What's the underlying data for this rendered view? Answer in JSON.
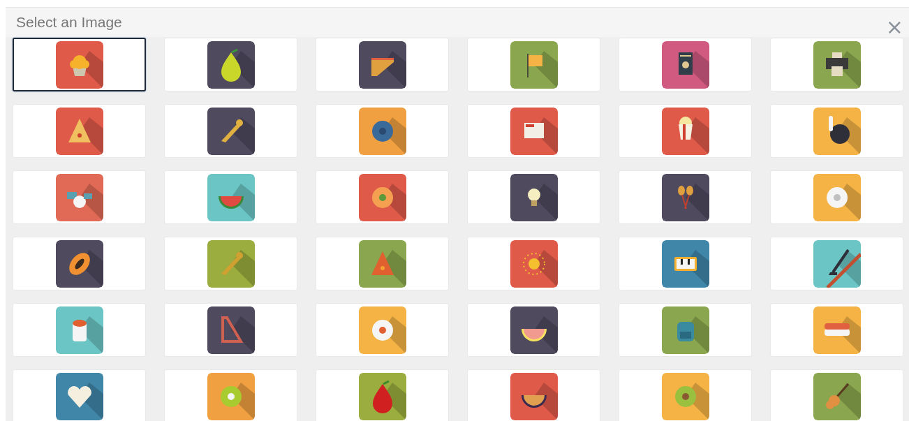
{
  "dialog": {
    "title": "Select an Image",
    "close": "×"
  },
  "tiles": [
    {
      "selected": true,
      "color": "#e05a4a"
    },
    {
      "selected": false,
      "color": "#4f4a5e"
    },
    {
      "selected": false,
      "color": "#4f4a5e"
    },
    {
      "selected": false,
      "color": "#8aa64e"
    },
    {
      "selected": false,
      "color": "#d05a80"
    },
    {
      "selected": false,
      "color": "#8aa64e"
    },
    {
      "selected": false,
      "color": "#e05a4a"
    },
    {
      "selected": false,
      "color": "#4f4a5e"
    },
    {
      "selected": false,
      "color": "#f0a040"
    },
    {
      "selected": false,
      "color": "#e05a4a"
    },
    {
      "selected": false,
      "color": "#e05a4a"
    },
    {
      "selected": false,
      "color": "#f5b345"
    },
    {
      "selected": false,
      "color": "#e06a55"
    },
    {
      "selected": false,
      "color": "#6cc5c5"
    },
    {
      "selected": false,
      "color": "#e05a4a"
    },
    {
      "selected": false,
      "color": "#4f4a5e"
    },
    {
      "selected": false,
      "color": "#4f4a5e"
    },
    {
      "selected": false,
      "color": "#f5b345"
    },
    {
      "selected": false,
      "color": "#4f4a5e"
    },
    {
      "selected": false,
      "color": "#9aad3e"
    },
    {
      "selected": false,
      "color": "#8aa64e"
    },
    {
      "selected": false,
      "color": "#e05a4a"
    },
    {
      "selected": false,
      "color": "#3f86a8"
    },
    {
      "selected": false,
      "color": "#6cc5c5"
    },
    {
      "selected": false,
      "color": "#6cc5c5"
    },
    {
      "selected": false,
      "color": "#4f4a5e"
    },
    {
      "selected": false,
      "color": "#f5b345"
    },
    {
      "selected": false,
      "color": "#4f4a5e"
    },
    {
      "selected": false,
      "color": "#8aa64e"
    },
    {
      "selected": false,
      "color": "#f5b345"
    },
    {
      "selected": false,
      "color": "#3f86a8"
    },
    {
      "selected": false,
      "color": "#f0a040"
    },
    {
      "selected": false,
      "color": "#9aad3e"
    },
    {
      "selected": false,
      "color": "#e05a4a"
    },
    {
      "selected": false,
      "color": "#f5b345"
    },
    {
      "selected": false,
      "color": "#8aa64e"
    }
  ]
}
